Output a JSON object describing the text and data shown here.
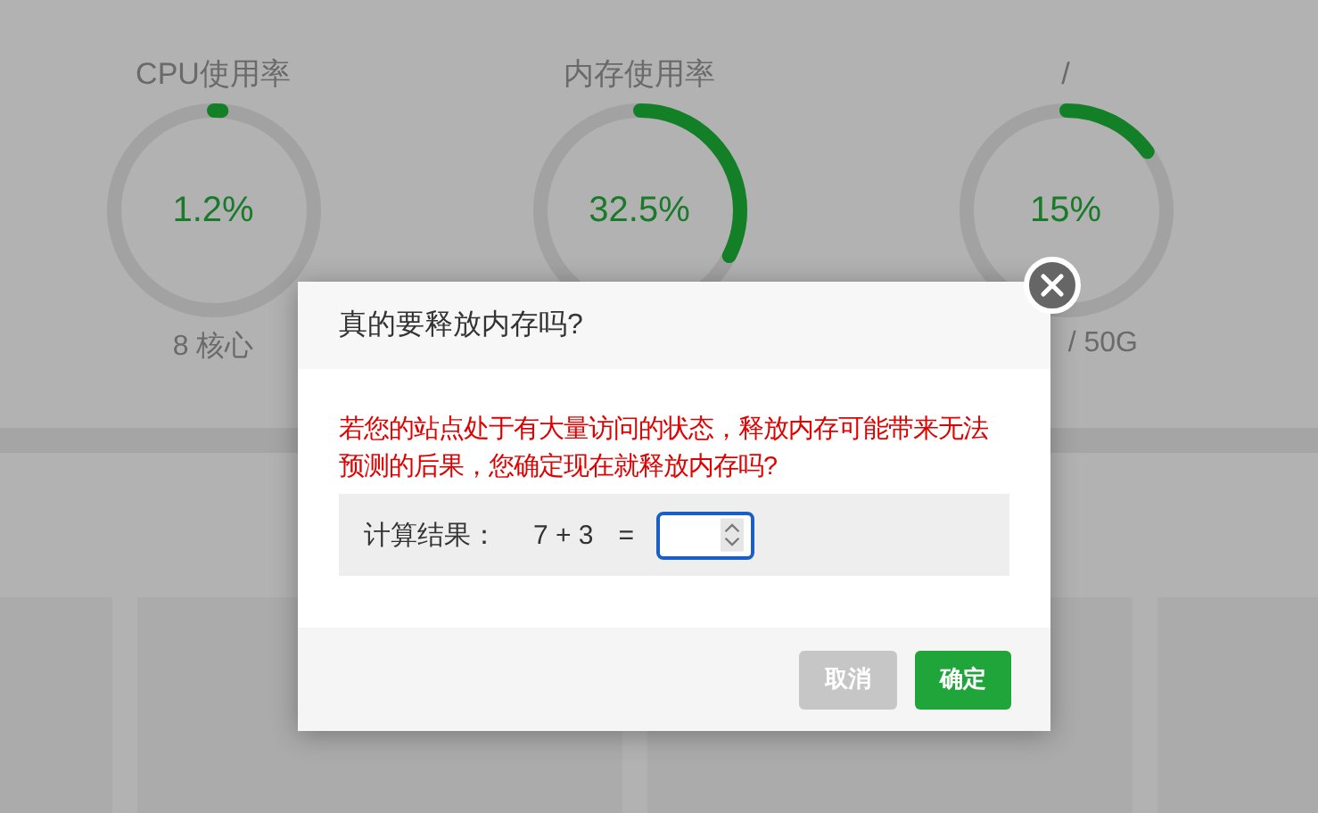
{
  "gauges": [
    {
      "label": "CPU使用率",
      "value": "1.2%",
      "level": 0.012,
      "detail": "8 核心"
    },
    {
      "label": "内存使用率",
      "value": "32.5%",
      "level": 0.325
    },
    {
      "label": "/",
      "value": "15%",
      "level": 0.15,
      "detail": "/ 50G"
    }
  ],
  "dialog": {
    "title": "真的要释放内存吗?",
    "message": "若您的站点处于有大量访问的状态，释放内存可能带来无法预测的后果，您确定现在就释放内存吗?",
    "captcha_label": "计算结果：",
    "expression": "7 + 3",
    "equals": "=",
    "buttons": [
      {
        "label": "取消",
        "kind": "cancel"
      },
      {
        "label": "确定",
        "kind": "confirm"
      }
    ]
  }
}
